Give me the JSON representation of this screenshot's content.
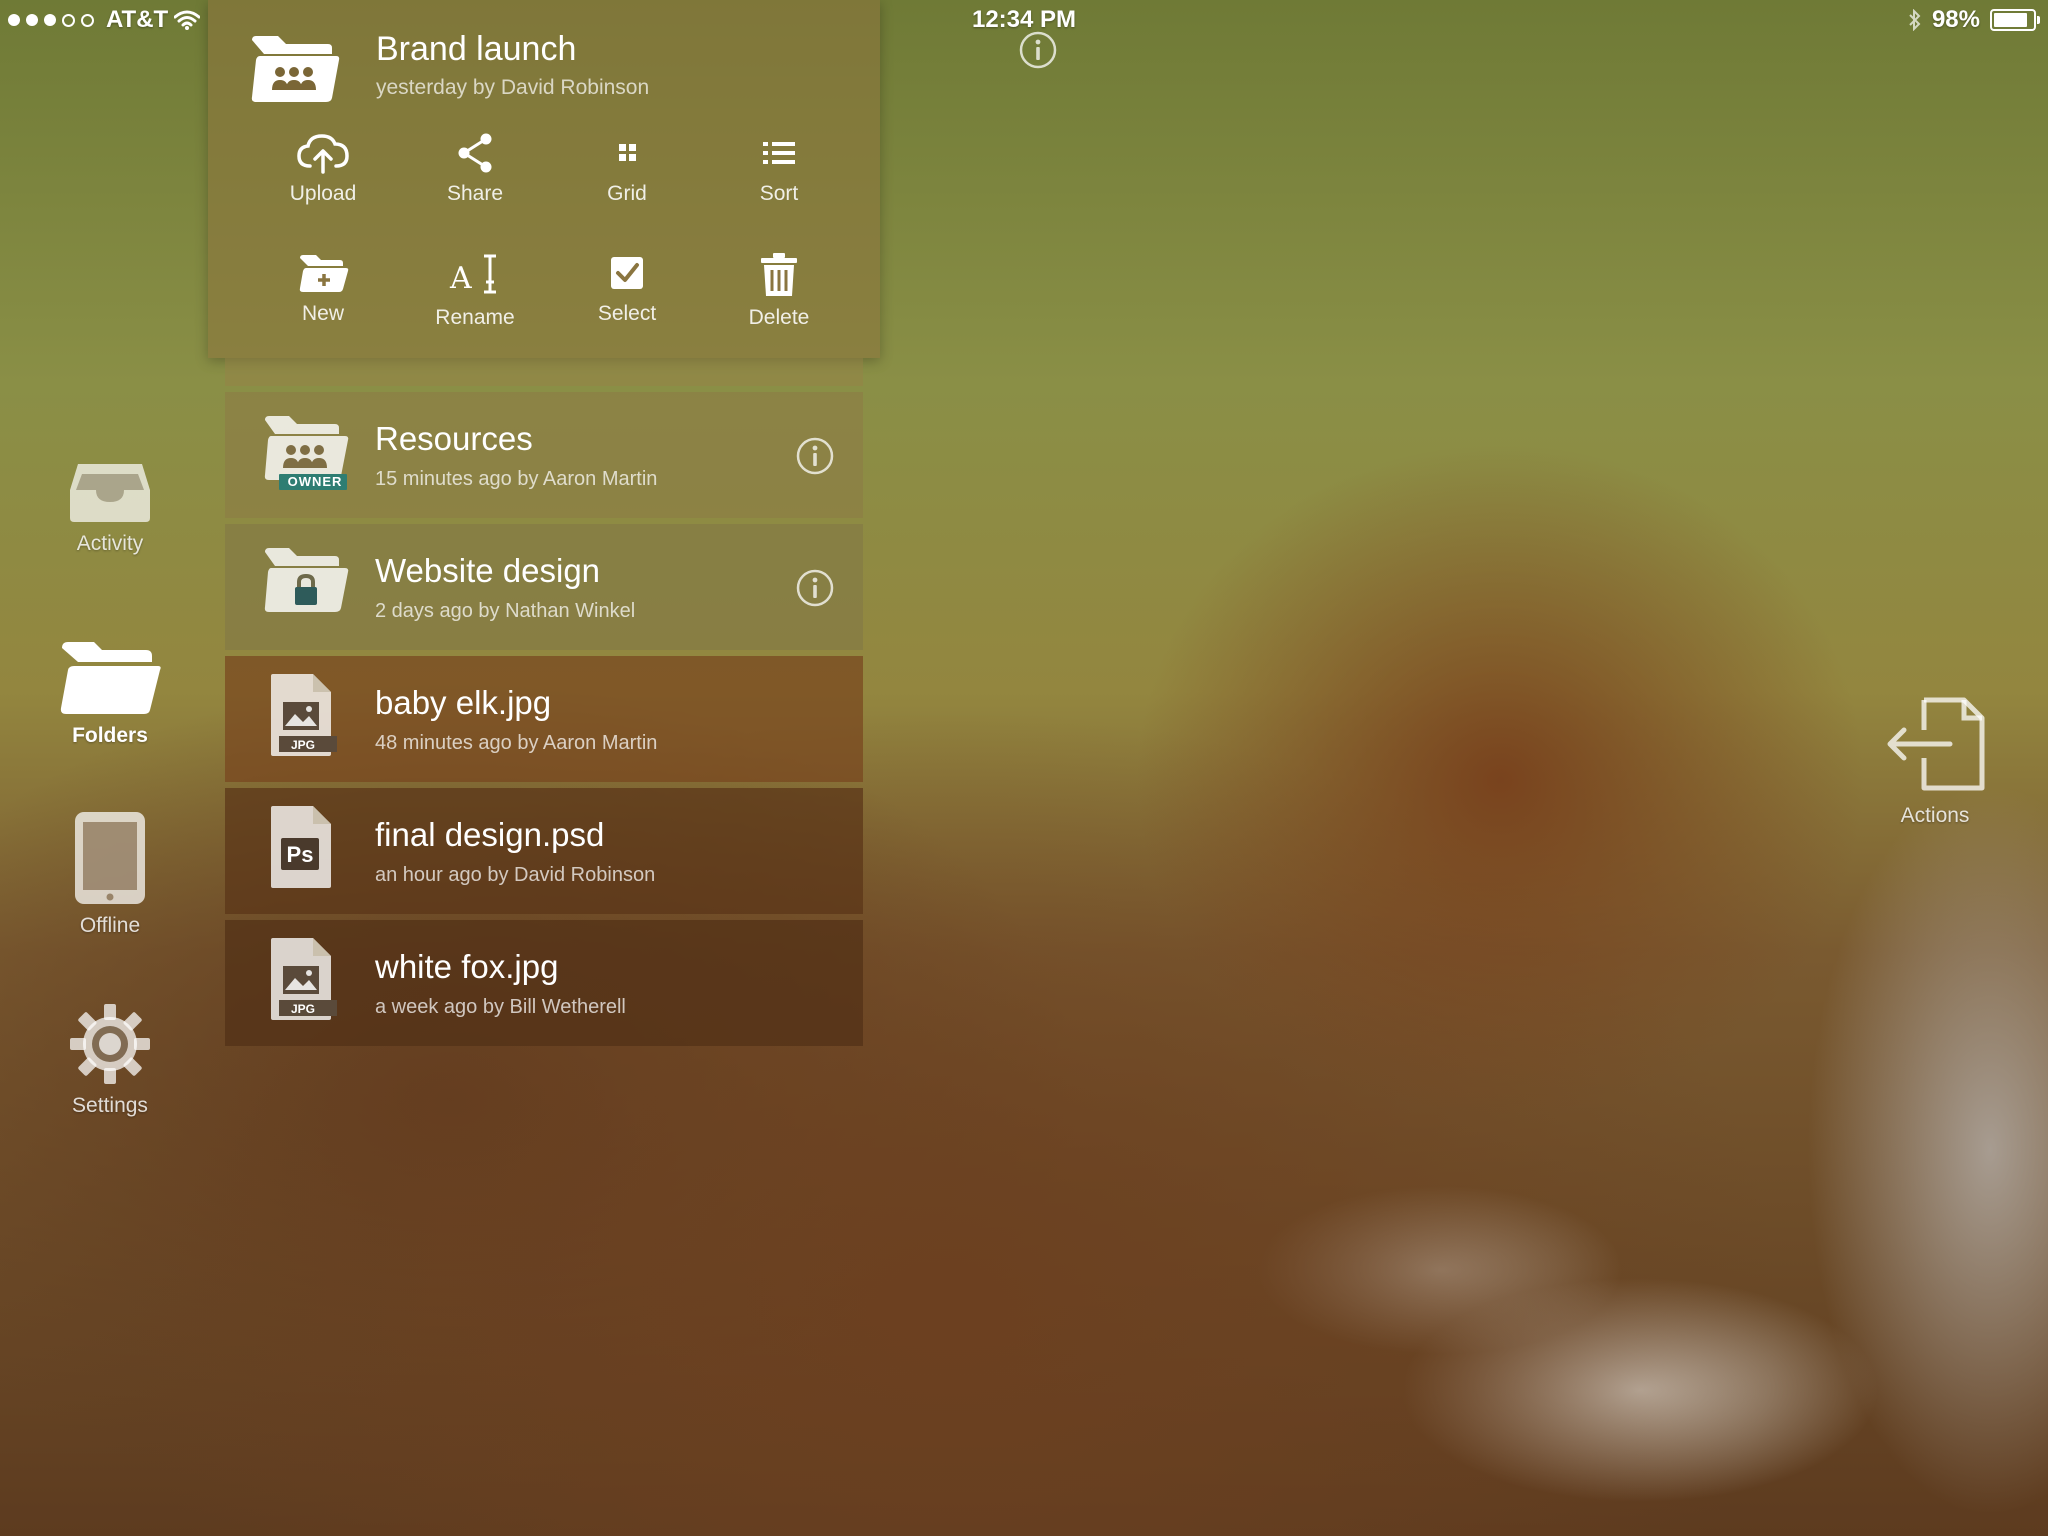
{
  "status_bar": {
    "carrier": "AT&T",
    "time": "12:34 PM",
    "battery": "98%",
    "battery_fraction": 0.98
  },
  "side_nav": {
    "items": [
      {
        "label": "Activity",
        "icon": "inbox-tray-icon"
      },
      {
        "label": "Folders",
        "icon": "folder-icon",
        "active": true
      },
      {
        "label": "Offline",
        "icon": "tablet-icon"
      },
      {
        "label": "Settings",
        "icon": "gear-icon"
      }
    ]
  },
  "current_folder": {
    "title": "Brand launch",
    "meta": "yesterday by David Robinson",
    "icon": "shared-folder-icon"
  },
  "toolbar": {
    "actions": [
      {
        "label": "Upload",
        "icon": "cloud-upload-icon"
      },
      {
        "label": "Share",
        "icon": "share-icon"
      },
      {
        "label": "Grid",
        "icon": "grid-icon"
      },
      {
        "label": "Sort",
        "icon": "list-icon"
      },
      {
        "label": "New",
        "icon": "new-folder-icon"
      },
      {
        "label": "Rename",
        "icon": "rename-icon"
      },
      {
        "label": "Select",
        "icon": "checkbox-icon"
      },
      {
        "label": "Delete",
        "icon": "trash-icon"
      }
    ]
  },
  "file_list": {
    "items": [
      {
        "name": "Resources",
        "meta": "15 minutes ago by Aaron Martin",
        "type": "shared-folder",
        "badge": "OWNER"
      },
      {
        "name": "Website design",
        "meta": "2 days ago by Nathan Winkel",
        "type": "locked-folder"
      },
      {
        "name": "baby elk.jpg",
        "meta": "48 minutes ago by Aaron Martin",
        "type": "jpg",
        "badge": "JPG"
      },
      {
        "name": "final design.psd",
        "meta": "an hour ago by David Robinson",
        "type": "psd",
        "badge": "Ps"
      },
      {
        "name": "white fox.jpg",
        "meta": "a week ago by Bill Wetherell",
        "type": "jpg",
        "badge": "JPG"
      }
    ]
  },
  "actions_side": {
    "label": "Actions",
    "icon": "file-export-icon"
  },
  "colors": {
    "panel": "#8c763c",
    "row_dark": "#5a371c",
    "badge_green": "#2e7d72"
  }
}
